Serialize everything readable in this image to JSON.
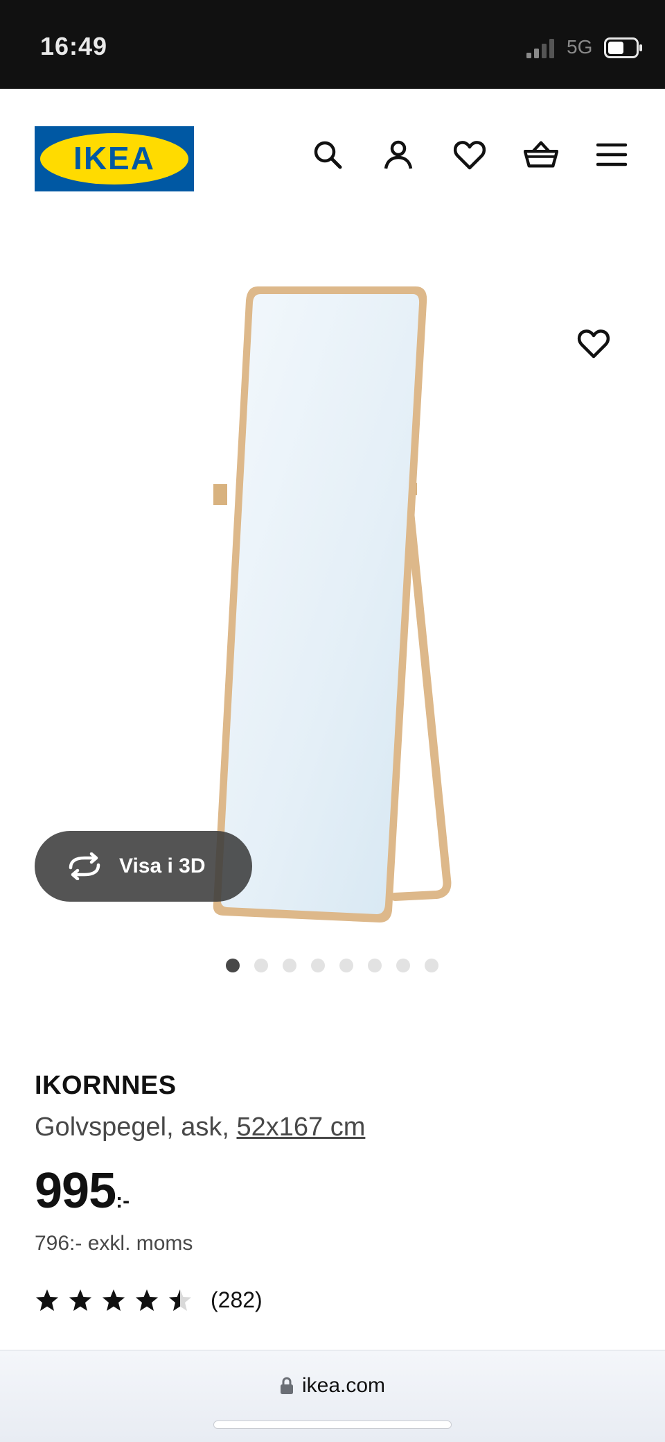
{
  "status_bar": {
    "time": "16:49",
    "network": "5G"
  },
  "header": {
    "logo_text": "IKEA",
    "icons": [
      "search-icon",
      "account-icon",
      "heart-icon",
      "basket-icon",
      "menu-icon"
    ]
  },
  "gallery": {
    "view_3d_label": "Visa i 3D",
    "dot_count": 8,
    "active_dot": 0
  },
  "product": {
    "name": "IKORNNES",
    "description_prefix": "Golvspegel, ask, ",
    "size": "52x167 cm",
    "price": "995",
    "price_suffix": ":-",
    "price_excl_vat": "796:- exkl. moms",
    "rating_value": 4.5,
    "rating_count": "(282)"
  },
  "browser": {
    "url": "ikea.com"
  },
  "colors": {
    "logo_blue": "#0058A3",
    "logo_yellow": "#FFDB00",
    "status_bar": "#111111",
    "frame_wood": "#DDB88A"
  }
}
